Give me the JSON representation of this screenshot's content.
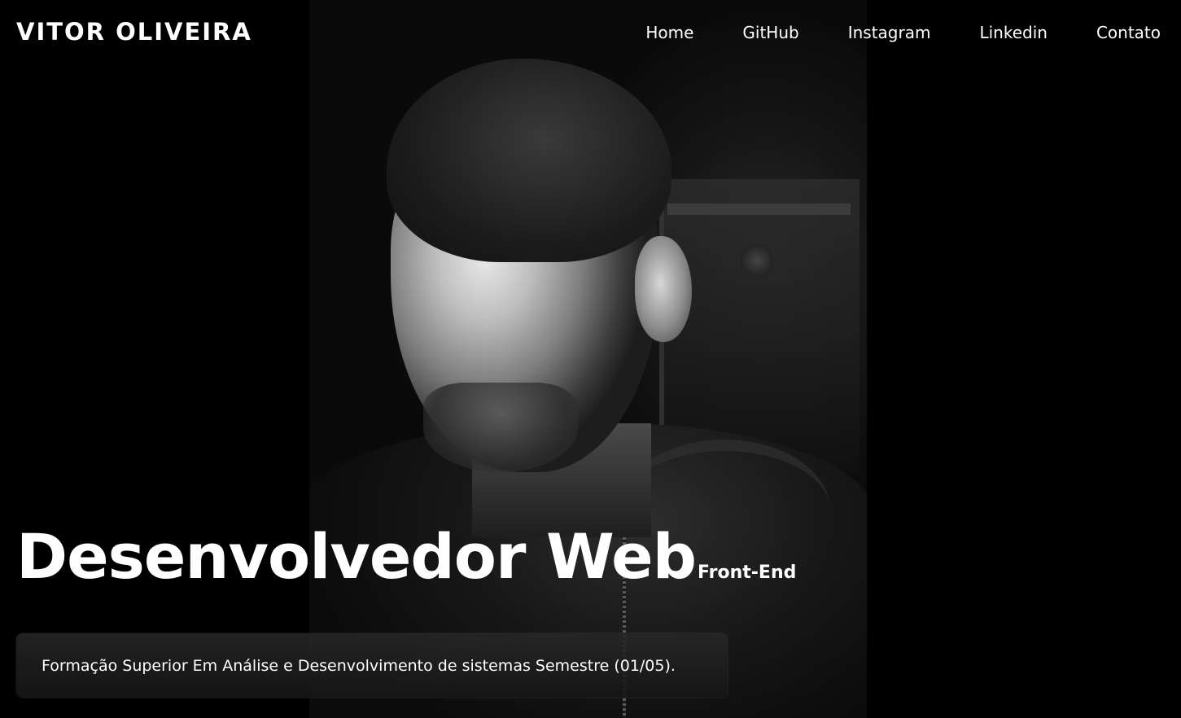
{
  "header": {
    "brand": "VITOR OLIVEIRA",
    "nav": [
      {
        "label": "Home"
      },
      {
        "label": "GitHub"
      },
      {
        "label": "Instagram"
      },
      {
        "label": "Linkedin"
      },
      {
        "label": "Contato"
      }
    ]
  },
  "hero": {
    "title": "Desenvolvedor Web",
    "subtitle": "Front-End",
    "description": "Formação Superior Em Análise e Desenvolvimento de sistemas Semestre (01/05)."
  },
  "colors": {
    "background": "#000000",
    "text": "#ffffff"
  }
}
